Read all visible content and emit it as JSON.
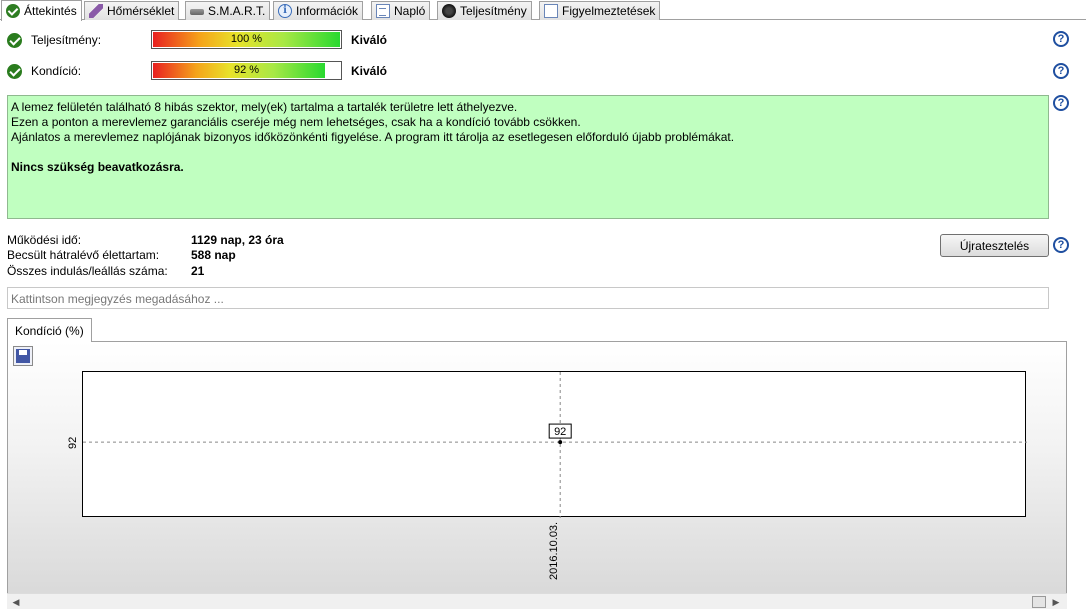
{
  "tabs": [
    {
      "label": "Áttekintés",
      "icon": "check-icon",
      "active": true
    },
    {
      "label": "Hőmérséklet",
      "icon": "thermometer-icon"
    },
    {
      "label": "S.M.A.R.T.",
      "icon": "smart-icon"
    },
    {
      "label": "Információk",
      "icon": "info-icon"
    },
    {
      "label": "Napló",
      "icon": "document-icon"
    },
    {
      "label": "Teljesítmény",
      "icon": "gauge-icon"
    },
    {
      "label": "Figyelmeztetések",
      "icon": "copy-icon"
    }
  ],
  "status": {
    "performance": {
      "label": "Teljesítmény:",
      "percent_text": "100 %",
      "level": 1.0,
      "rating": "Kiváló"
    },
    "condition": {
      "label": "Kondíció:",
      "percent_text": "92 %",
      "level": 0.92,
      "rating": "Kiváló"
    }
  },
  "message": {
    "lines": [
      "A lemez felületén található 8 hibás szektor, mely(ek) tartalma a tartalék területre lett áthelyezve.",
      "Ezen a ponton a merevlemez garanciális cseréje még nem lehetséges, csak ha a kondíció tovább csökken.",
      "Ajánlatos a merevlemez naplójának bizonyos időközönkénti figyelése. A program itt tárolja az esetlegesen előforduló újabb problémákat."
    ],
    "bold_line": "Nincs szükség beavatkozásra."
  },
  "stats": {
    "uptime_label": "Működési idő:",
    "uptime_value": "1129 nap, 23 óra",
    "remaining_label": "Becsült hátralévő élettartam:",
    "remaining_value": "588 nap",
    "starts_label": "Összes indulás/leállás száma:",
    "starts_value": "21"
  },
  "retest_button": "Újratesztelés",
  "note_placeholder": "Kattintson megjegyzés megadásához ...",
  "help_symbol": "?",
  "chart_tab_label": "Kondíció  (%)",
  "colors": {
    "message_bg": "#c0ffc0",
    "check": "#2a7c1e",
    "help": "#1f4fa0"
  },
  "chart_data": {
    "type": "line",
    "title": "",
    "xlabel": "",
    "ylabel": "",
    "x": [
      "2016.10.03."
    ],
    "series": [
      {
        "values": [
          92
        ]
      }
    ],
    "data_labels": [
      "92"
    ],
    "ytick_labels": [
      "92"
    ],
    "xtick_labels": [
      "2016.10.03."
    ],
    "grid": true
  }
}
